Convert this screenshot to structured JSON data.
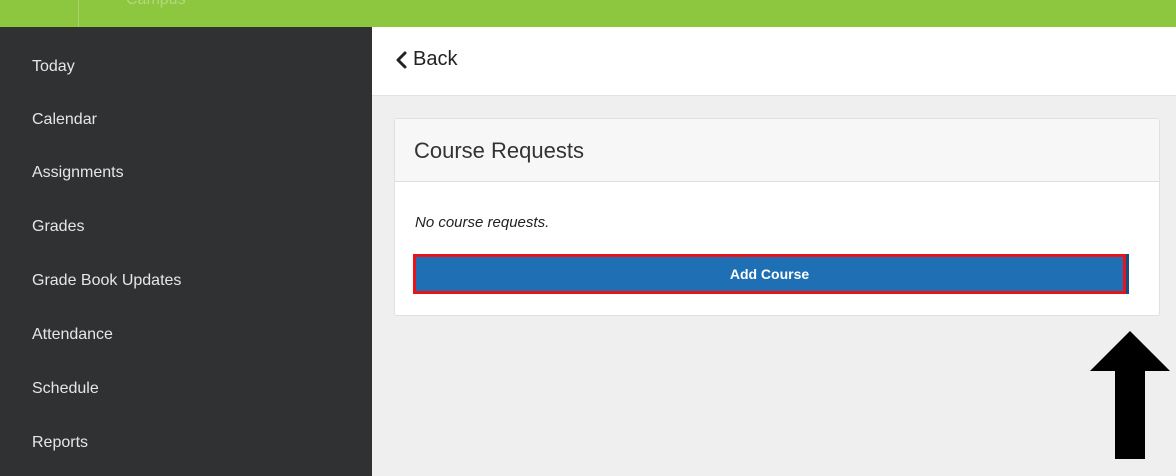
{
  "topbar": {
    "app_name": "Campus",
    "color": "#8dc63f"
  },
  "sidebar": {
    "items": [
      {
        "label": "Today"
      },
      {
        "label": "Calendar"
      },
      {
        "label": "Assignments"
      },
      {
        "label": "Grades"
      },
      {
        "label": "Grade Book Updates"
      },
      {
        "label": "Attendance"
      },
      {
        "label": "Schedule"
      },
      {
        "label": "Reports"
      }
    ]
  },
  "main": {
    "back_label": "Back",
    "card": {
      "title": "Course Requests",
      "empty_message": "No course requests.",
      "add_button_label": "Add Course"
    }
  },
  "colors": {
    "sidebar_bg": "#2f3133",
    "button_bg": "#1f6fb4",
    "highlight": "#e8141b"
  },
  "annotation": {
    "icon": "up-arrow-icon"
  }
}
